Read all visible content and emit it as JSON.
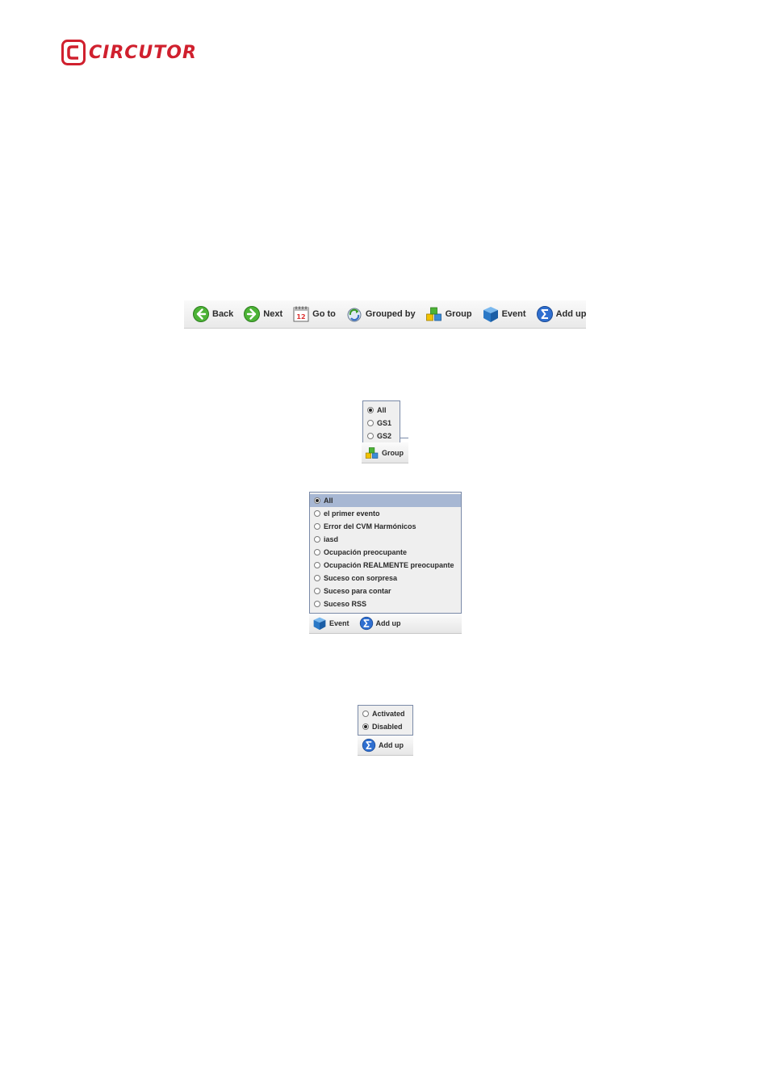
{
  "brand": {
    "name": "CIRCUTOR",
    "color": "#d0202e"
  },
  "toolbar": {
    "buttons": [
      {
        "label": "Back",
        "icon": "back-arrow-icon"
      },
      {
        "label": "Next",
        "icon": "next-arrow-icon"
      },
      {
        "label": "Go to",
        "icon": "calendar-icon"
      },
      {
        "label": "Grouped by",
        "icon": "refresh-icon"
      },
      {
        "label": "Group",
        "icon": "cubes-icon"
      },
      {
        "label": "Event",
        "icon": "cube-icon"
      },
      {
        "label": "Add up",
        "icon": "sigma-icon"
      }
    ],
    "calendar_day": "12"
  },
  "group_popup": {
    "options": [
      {
        "label": "All",
        "checked": true
      },
      {
        "label": "GS1",
        "checked": false
      },
      {
        "label": "GS2",
        "checked": false
      }
    ],
    "button_label": "Group"
  },
  "event_popup": {
    "options": [
      {
        "label": "All",
        "checked": true
      },
      {
        "label": "el primer evento",
        "checked": false
      },
      {
        "label": "Error del CVM Harmónicos",
        "checked": false
      },
      {
        "label": "iasd",
        "checked": false
      },
      {
        "label": "Ocupación preocupante",
        "checked": false
      },
      {
        "label": "Ocupación REALMENTE preocupante",
        "checked": false
      },
      {
        "label": "Suceso con sorpresa",
        "checked": false
      },
      {
        "label": "Suceso para contar",
        "checked": false
      },
      {
        "label": "Suceso RSS",
        "checked": false
      }
    ],
    "event_label": "Event",
    "addup_label": "Add up"
  },
  "addup_popup": {
    "options": [
      {
        "label": "Activated",
        "checked": false
      },
      {
        "label": "Disabled",
        "checked": true
      }
    ],
    "button_label": "Add up"
  }
}
